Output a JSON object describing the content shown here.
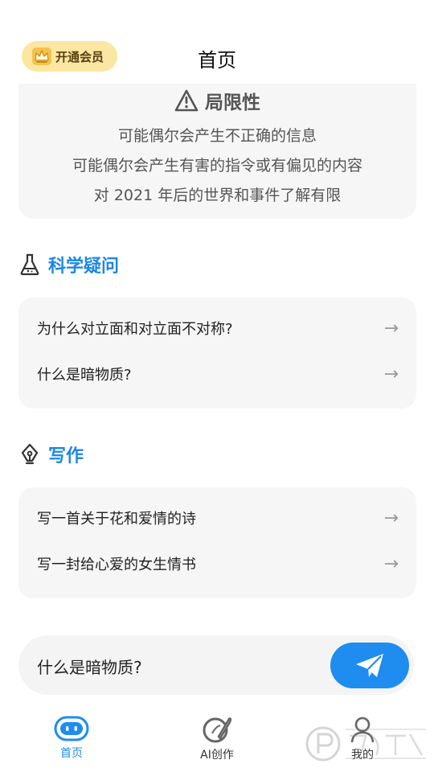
{
  "header": {
    "vip_label": "开通会员",
    "title": "首页"
  },
  "limitations": {
    "title": "局限性",
    "lines": [
      "可能偶尔会产生不正确的信息",
      "可能偶尔会产生有害的指令或有偏见的内容",
      "对 2021 年后的世界和事件了解有限"
    ]
  },
  "sections": [
    {
      "title": "科学疑问",
      "icon": "flask-icon",
      "questions": [
        "为什么对立面和对立面不对称?",
        "什么是暗物质?"
      ]
    },
    {
      "title": "写作",
      "icon": "pen-nib-icon",
      "questions": [
        "写一首关于花和爱情的诗",
        "写一封给心爱的女生情书"
      ]
    }
  ],
  "arrow_glyph": "→",
  "input": {
    "value": "什么是暗物质?"
  },
  "tabbar": {
    "tabs": [
      {
        "label": "首页",
        "icon": "robot-icon",
        "active": true
      },
      {
        "label": "AI创作",
        "icon": "quill-icon",
        "active": false
      },
      {
        "label": "我的",
        "icon": "user-icon",
        "active": false
      }
    ]
  },
  "colors": {
    "accent": "#1d87e4",
    "send_button": "#1f8cf0",
    "vip_bg": "#fbe7a1",
    "card_bg": "#f6f6f6"
  }
}
